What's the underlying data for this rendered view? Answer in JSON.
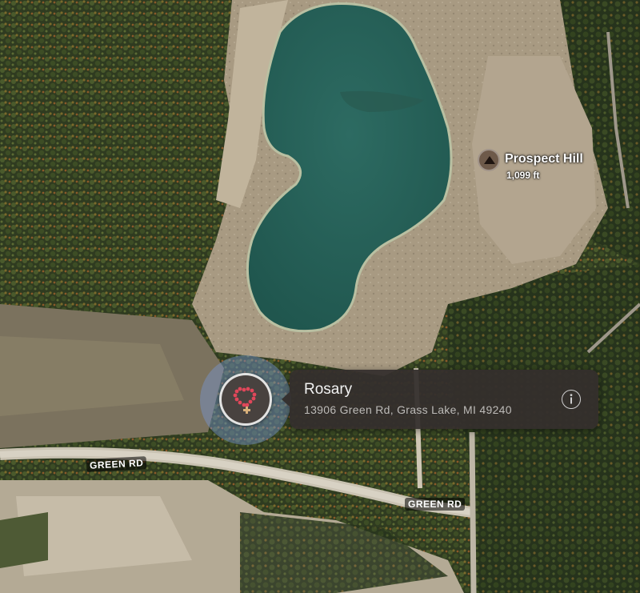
{
  "map": {
    "type": "satellite",
    "road_labels": [
      "GREEN RD",
      "GREEN RD"
    ],
    "peak": {
      "icon": "mountain-peak-icon",
      "name": "Prospect Hill",
      "elevation": "1,099 ft"
    }
  },
  "place_callout": {
    "title": "Rosary",
    "address": "13906 Green Rd, Grass Lake, MI  49240",
    "pin_icon": "rosary-icon",
    "info_icon": "info-icon",
    "pin_color": "#e0475a"
  }
}
